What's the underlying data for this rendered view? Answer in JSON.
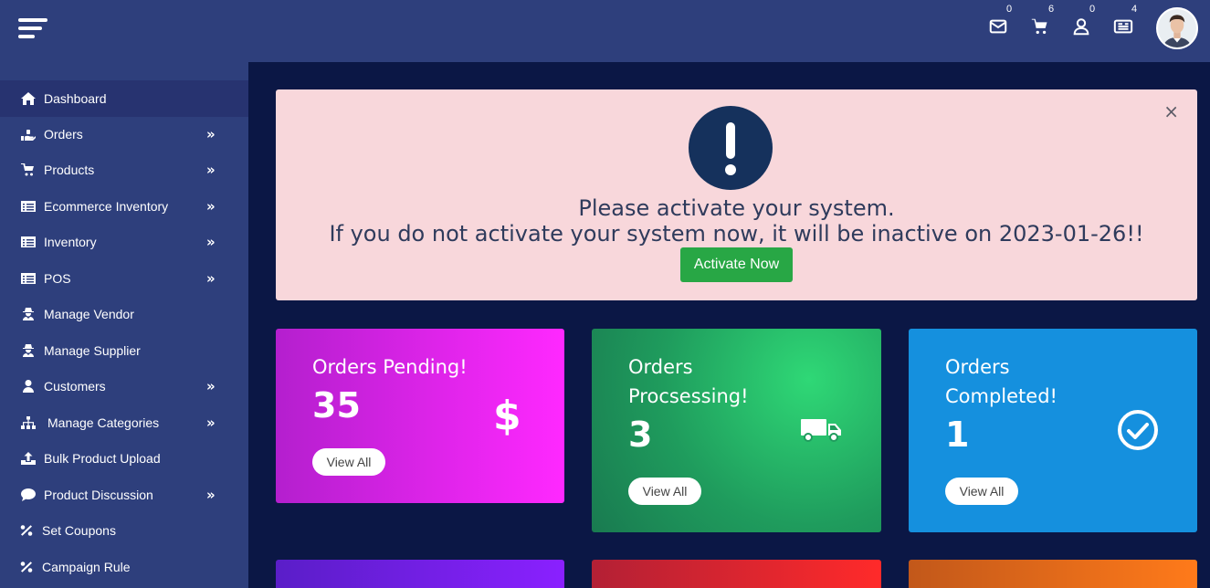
{
  "header": {
    "icons": [
      {
        "name": "envelope-icon",
        "badge": "0"
      },
      {
        "name": "cart-icon",
        "badge": "6"
      },
      {
        "name": "user-icon",
        "badge": "0"
      },
      {
        "name": "newspaper-icon",
        "badge": "4"
      }
    ]
  },
  "sidebar": {
    "items": [
      {
        "label": "Dashboard",
        "icon": "home-icon",
        "has_submenu": false,
        "active": true
      },
      {
        "label": "Orders",
        "icon": "hand-holding-icon",
        "has_submenu": true
      },
      {
        "label": "Products",
        "icon": "cart-icon",
        "has_submenu": true
      },
      {
        "label": "Ecommerce Inventory",
        "icon": "list-alt-icon",
        "has_submenu": true
      },
      {
        "label": "Inventory",
        "icon": "list-alt-icon",
        "has_submenu": true
      },
      {
        "label": "POS",
        "icon": "list-alt-icon",
        "has_submenu": true
      },
      {
        "label": "Manage Vendor",
        "icon": "user-secret-icon",
        "has_submenu": false
      },
      {
        "label": "Manage Supplier",
        "icon": "user-secret-icon",
        "has_submenu": false
      },
      {
        "label": "Customers",
        "icon": "user-icon",
        "has_submenu": true
      },
      {
        "label": "Manage Categories",
        "icon": "sitemap-icon",
        "has_submenu": true
      },
      {
        "label": "Bulk Product Upload",
        "icon": "upload-icon",
        "has_submenu": false
      },
      {
        "label": "Product Discussion",
        "icon": "comment-icon",
        "has_submenu": true
      },
      {
        "label": "Set Coupons",
        "icon": "percent-icon",
        "has_submenu": false
      },
      {
        "label": "Campaign Rule",
        "icon": "percent-icon",
        "has_submenu": false
      }
    ],
    "chevron": "»"
  },
  "alert": {
    "close": "×",
    "line1": "Please activate your system.",
    "line2": "If you do not activate your system now, it will be inactive on 2023-01-26!!",
    "button": "Activate Now"
  },
  "cards": [
    {
      "title": "Orders Pending!",
      "count": "35",
      "button": "View All",
      "icon": "dollar-icon",
      "color": "#ff28ff"
    },
    {
      "title_line1": "Orders",
      "title_line2": "Procsessing!",
      "count": "3",
      "button": "View All",
      "icon": "truck-icon",
      "color": "#2fd876"
    },
    {
      "title_line1": "Orders",
      "title_line2": "Completed!",
      "count": "1",
      "button": "View All",
      "icon": "check-circle-icon",
      "color": "#1590de"
    }
  ],
  "colors": {
    "topbar": "#2e3f7c",
    "background": "#0b1745",
    "alert_bg": "#f8d7db",
    "success": "#28a745"
  }
}
